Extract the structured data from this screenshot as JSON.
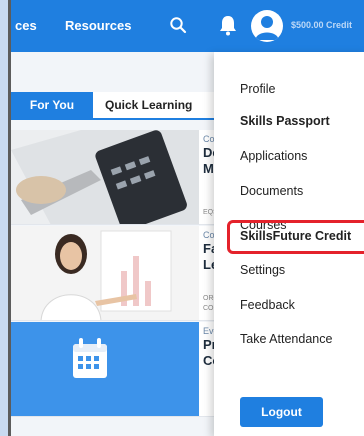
{
  "navbar": {
    "truncated_label": "ces",
    "resources_label": "Resources",
    "credit_label": "$500.00 Credit",
    "icons": [
      "search-icon",
      "bell-icon",
      "avatar-icon"
    ]
  },
  "tabs": {
    "for_you": "For You",
    "quick_learning": "Quick Learning"
  },
  "cards": [
    {
      "category": "Course",
      "title_line1": "Deve",
      "title_line2": "Mana",
      "meta_line1": "EQS AS",
      "meta_line2": ""
    },
    {
      "category": "Course",
      "title_line1": "Facil",
      "title_line2": "Lead",
      "meta_line1": "ORGAN",
      "meta_line2": "CONCE"
    },
    {
      "category": "Events",
      "title_line1": "Pract",
      "title_line2": "Comp",
      "meta_line1": "",
      "meta_line2": ""
    }
  ],
  "menu": {
    "items": [
      {
        "label": "Profile",
        "bold": false
      },
      {
        "label": "Skills Passport",
        "bold": true
      },
      {
        "label": "Applications",
        "bold": false
      },
      {
        "label": "Documents",
        "bold": false
      },
      {
        "label": "Courses",
        "bold": false
      },
      {
        "label": "SkillsFuture Credit",
        "bold": true
      },
      {
        "label": "Settings",
        "bold": false
      },
      {
        "label": "Feedback",
        "bold": false
      },
      {
        "label": "Take Attendance",
        "bold": false
      }
    ],
    "highlighted_item": "SkillsFuture Credit",
    "logout_label": "Logout"
  },
  "colors": {
    "primary": "#1f7fe0",
    "highlight_border": "#e4222b",
    "page_background": "#c9daf0"
  }
}
